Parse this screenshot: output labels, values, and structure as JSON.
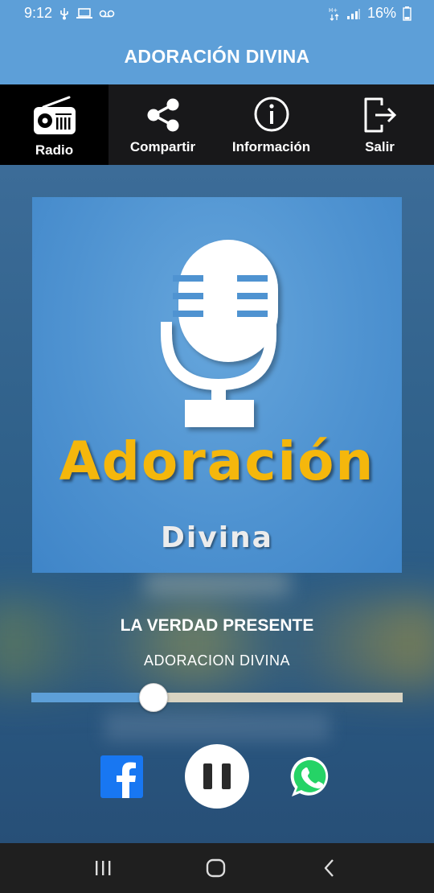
{
  "status_bar": {
    "time": "9:12",
    "battery": "16%",
    "icons": [
      "usb-icon",
      "laptop-icon",
      "voicemail-icon",
      "network-icon",
      "signal-icon",
      "battery-icon"
    ]
  },
  "app_bar": {
    "title": "ADORACIÓN DIVINA"
  },
  "tabs": [
    {
      "label": "Radio",
      "icon": "radio-icon",
      "active": true
    },
    {
      "label": "Compartir",
      "icon": "share-icon",
      "active": false
    },
    {
      "label": "Información",
      "icon": "info-icon",
      "active": false
    },
    {
      "label": "Salir",
      "icon": "exit-icon",
      "active": false
    }
  ],
  "cover": {
    "logo_title": "Adoración",
    "logo_subtitle": "Divina",
    "icon": "microphone-icon"
  },
  "player": {
    "track_title": "LA VERDAD PRESENTE",
    "artist": "ADORACION DIVINA",
    "progress": 0.33,
    "state": "playing"
  },
  "actions": {
    "facebook_icon": "facebook-icon",
    "pause_icon": "pause-icon",
    "whatsapp_icon": "whatsapp-icon"
  },
  "nav_bar": {
    "icons": [
      "recent-apps-icon",
      "home-icon",
      "back-icon"
    ]
  },
  "colors": {
    "primary": "#5d9fd8",
    "tab_bar": "#18181a",
    "logo_title": "#f5b70c",
    "facebook": "#1877f2",
    "whatsapp": "#25d366"
  }
}
